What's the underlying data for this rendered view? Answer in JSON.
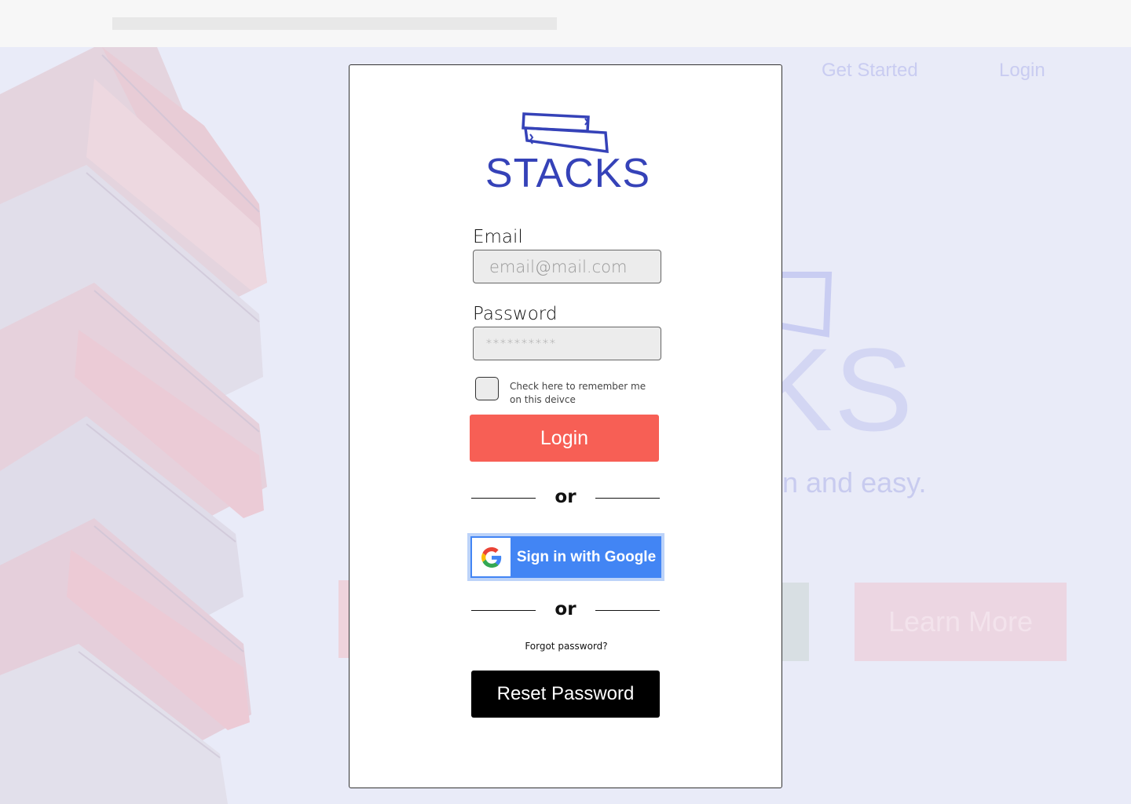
{
  "background": {
    "nav_get_started": "Get Started",
    "nav_login": "Login",
    "logo_text_partial": "KS",
    "tagline_partial": "n and easy.",
    "learn_more": "Learn More"
  },
  "modal": {
    "logo_text": "STACKS",
    "email_label": "Email",
    "email_placeholder": "email@mail.com",
    "password_label": "Password",
    "password_value": "**********",
    "remember_label": "Check here to remember me on this deivce",
    "login_button": "Login",
    "divider_text": "or",
    "google_button": "Sign in with Google",
    "forgot_text": "Forgot password?",
    "reset_button": "Reset Password"
  },
  "colors": {
    "brand": "#3542b8",
    "login_button": "#f75f55",
    "google_blue": "#4285f4",
    "reset_button": "#000000",
    "backdrop": "#e9ebf8"
  },
  "icons": [
    "stacks-logo-icon",
    "google-g-icon",
    "book-stack-image"
  ]
}
